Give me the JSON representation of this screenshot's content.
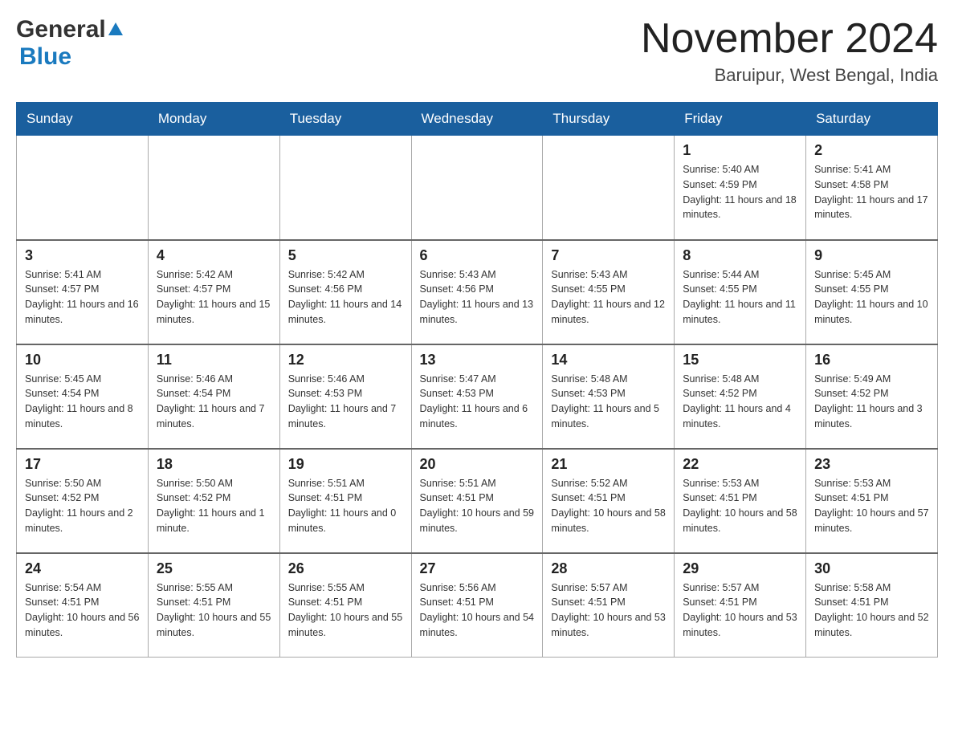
{
  "logo": {
    "general": "General",
    "blue": "Blue"
  },
  "title": {
    "month": "November 2024",
    "location": "Baruipur, West Bengal, India"
  },
  "weekdays": [
    "Sunday",
    "Monday",
    "Tuesday",
    "Wednesday",
    "Thursday",
    "Friday",
    "Saturday"
  ],
  "weeks": [
    [
      {
        "day": "",
        "info": ""
      },
      {
        "day": "",
        "info": ""
      },
      {
        "day": "",
        "info": ""
      },
      {
        "day": "",
        "info": ""
      },
      {
        "day": "",
        "info": ""
      },
      {
        "day": "1",
        "info": "Sunrise: 5:40 AM\nSunset: 4:59 PM\nDaylight: 11 hours and 18 minutes."
      },
      {
        "day": "2",
        "info": "Sunrise: 5:41 AM\nSunset: 4:58 PM\nDaylight: 11 hours and 17 minutes."
      }
    ],
    [
      {
        "day": "3",
        "info": "Sunrise: 5:41 AM\nSunset: 4:57 PM\nDaylight: 11 hours and 16 minutes."
      },
      {
        "day": "4",
        "info": "Sunrise: 5:42 AM\nSunset: 4:57 PM\nDaylight: 11 hours and 15 minutes."
      },
      {
        "day": "5",
        "info": "Sunrise: 5:42 AM\nSunset: 4:56 PM\nDaylight: 11 hours and 14 minutes."
      },
      {
        "day": "6",
        "info": "Sunrise: 5:43 AM\nSunset: 4:56 PM\nDaylight: 11 hours and 13 minutes."
      },
      {
        "day": "7",
        "info": "Sunrise: 5:43 AM\nSunset: 4:55 PM\nDaylight: 11 hours and 12 minutes."
      },
      {
        "day": "8",
        "info": "Sunrise: 5:44 AM\nSunset: 4:55 PM\nDaylight: 11 hours and 11 minutes."
      },
      {
        "day": "9",
        "info": "Sunrise: 5:45 AM\nSunset: 4:55 PM\nDaylight: 11 hours and 10 minutes."
      }
    ],
    [
      {
        "day": "10",
        "info": "Sunrise: 5:45 AM\nSunset: 4:54 PM\nDaylight: 11 hours and 8 minutes."
      },
      {
        "day": "11",
        "info": "Sunrise: 5:46 AM\nSunset: 4:54 PM\nDaylight: 11 hours and 7 minutes."
      },
      {
        "day": "12",
        "info": "Sunrise: 5:46 AM\nSunset: 4:53 PM\nDaylight: 11 hours and 7 minutes."
      },
      {
        "day": "13",
        "info": "Sunrise: 5:47 AM\nSunset: 4:53 PM\nDaylight: 11 hours and 6 minutes."
      },
      {
        "day": "14",
        "info": "Sunrise: 5:48 AM\nSunset: 4:53 PM\nDaylight: 11 hours and 5 minutes."
      },
      {
        "day": "15",
        "info": "Sunrise: 5:48 AM\nSunset: 4:52 PM\nDaylight: 11 hours and 4 minutes."
      },
      {
        "day": "16",
        "info": "Sunrise: 5:49 AM\nSunset: 4:52 PM\nDaylight: 11 hours and 3 minutes."
      }
    ],
    [
      {
        "day": "17",
        "info": "Sunrise: 5:50 AM\nSunset: 4:52 PM\nDaylight: 11 hours and 2 minutes."
      },
      {
        "day": "18",
        "info": "Sunrise: 5:50 AM\nSunset: 4:52 PM\nDaylight: 11 hours and 1 minute."
      },
      {
        "day": "19",
        "info": "Sunrise: 5:51 AM\nSunset: 4:51 PM\nDaylight: 11 hours and 0 minutes."
      },
      {
        "day": "20",
        "info": "Sunrise: 5:51 AM\nSunset: 4:51 PM\nDaylight: 10 hours and 59 minutes."
      },
      {
        "day": "21",
        "info": "Sunrise: 5:52 AM\nSunset: 4:51 PM\nDaylight: 10 hours and 58 minutes."
      },
      {
        "day": "22",
        "info": "Sunrise: 5:53 AM\nSunset: 4:51 PM\nDaylight: 10 hours and 58 minutes."
      },
      {
        "day": "23",
        "info": "Sunrise: 5:53 AM\nSunset: 4:51 PM\nDaylight: 10 hours and 57 minutes."
      }
    ],
    [
      {
        "day": "24",
        "info": "Sunrise: 5:54 AM\nSunset: 4:51 PM\nDaylight: 10 hours and 56 minutes."
      },
      {
        "day": "25",
        "info": "Sunrise: 5:55 AM\nSunset: 4:51 PM\nDaylight: 10 hours and 55 minutes."
      },
      {
        "day": "26",
        "info": "Sunrise: 5:55 AM\nSunset: 4:51 PM\nDaylight: 10 hours and 55 minutes."
      },
      {
        "day": "27",
        "info": "Sunrise: 5:56 AM\nSunset: 4:51 PM\nDaylight: 10 hours and 54 minutes."
      },
      {
        "day": "28",
        "info": "Sunrise: 5:57 AM\nSunset: 4:51 PM\nDaylight: 10 hours and 53 minutes."
      },
      {
        "day": "29",
        "info": "Sunrise: 5:57 AM\nSunset: 4:51 PM\nDaylight: 10 hours and 53 minutes."
      },
      {
        "day": "30",
        "info": "Sunrise: 5:58 AM\nSunset: 4:51 PM\nDaylight: 10 hours and 52 minutes."
      }
    ]
  ]
}
